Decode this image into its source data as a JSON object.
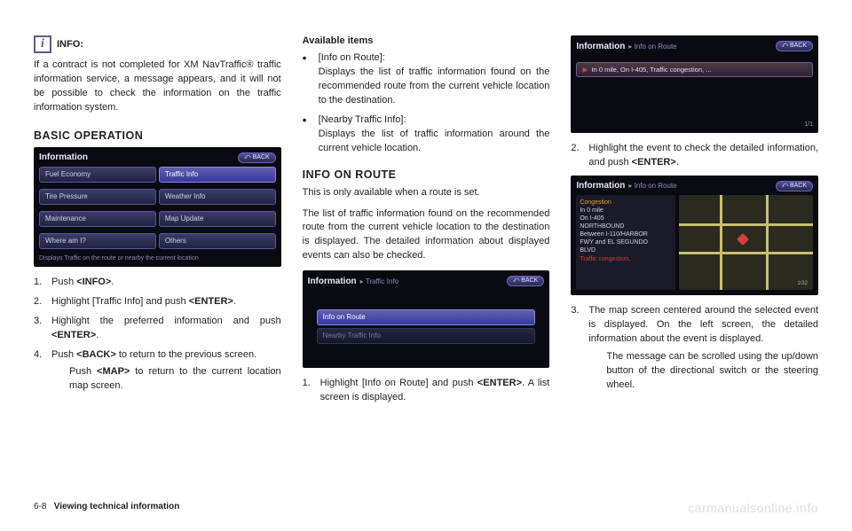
{
  "col1": {
    "info_label": "INFO:",
    "info_text": "If a contract is not completed for XM NavTraffic® traffic information service, a message appears, and it will not be possible to check the information on the traffic information system.",
    "heading": "BASIC OPERATION",
    "screenshot": {
      "title": "Information",
      "back": "BACK",
      "menu_left": [
        "Fuel Economy",
        "Tire Pressure",
        "Maintenance",
        "Where am I?"
      ],
      "menu_right": [
        "Traffic Info",
        "Weather Info",
        "Map Update",
        "Others"
      ],
      "footer": "Displays Traffic on the route or nearby the current location"
    },
    "steps": [
      {
        "text_a": "Push ",
        "bold": "<INFO>",
        "text_b": "."
      },
      {
        "text_a": "Highlight [Traffic Info] and push ",
        "bold": "<ENTER>",
        "text_b": "."
      },
      {
        "text_a": "Highlight the preferred information and push ",
        "bold": "<ENTER>",
        "text_b": "."
      },
      {
        "text_a": "Push ",
        "bold": "<BACK>",
        "text_b": " to return to the previous screen.",
        "sub_a": "Push ",
        "sub_bold": "<MAP>",
        "sub_b": " to return to the current location map screen."
      }
    ]
  },
  "col2": {
    "avail_heading": "Available items",
    "bullets": [
      {
        "title": "[Info on Route]:",
        "desc": "Displays the list of traffic information found on the recommended route from the current vehicle location to the destination."
      },
      {
        "title": "[Nearby Traffic Info]:",
        "desc": "Displays the list of traffic information around the current vehicle location."
      }
    ],
    "heading": "INFO ON ROUTE",
    "para1": "This is only available when a route is set.",
    "para2": "The list of traffic information found on the recommended route from the current vehicle location to the destination is displayed. The detailed information about displayed events can also be checked.",
    "screenshot": {
      "title_main": "Information",
      "title_sub": "▸ Traffic Info",
      "back": "BACK",
      "items": [
        "Info on Route",
        "Nearby Traffic Info"
      ]
    },
    "step1_a": "Highlight [Info on Route] and push ",
    "step1_bold": "<ENTER>",
    "step1_b": ". A list screen is displayed."
  },
  "col3": {
    "screenshot1": {
      "title_main": "Information",
      "title_sub": "▸ Info on Route",
      "back": "BACK",
      "row": "In 0 mile, On I-405, Traffic congestion, ...",
      "page": "1/1"
    },
    "step2_a": "Highlight the event to check the detailed information, and push ",
    "step2_bold": "<ENTER>",
    "step2_b": ".",
    "screenshot2": {
      "title_main": "Information",
      "title_sub": "▸ Info on Route",
      "back": "BACK",
      "left_warn": "Congestion",
      "left_lines": "In 0 mile\nOn I-405\nNORTHBOUND\nBetween I-110/HARBOR\nFWY and EL SEGUNDO\nBLVD",
      "left_red": "Traffic congestion,"
    },
    "step3": "The map screen centered around the selected event is displayed. On the left screen, the detailed information about the event is displayed.",
    "step3_sub": "The message can be scrolled using the up/down button of the directional switch or the steering wheel."
  },
  "footer": {
    "num": "6-8",
    "text": "Viewing technical information"
  },
  "watermark": "carmanualsonline.info"
}
